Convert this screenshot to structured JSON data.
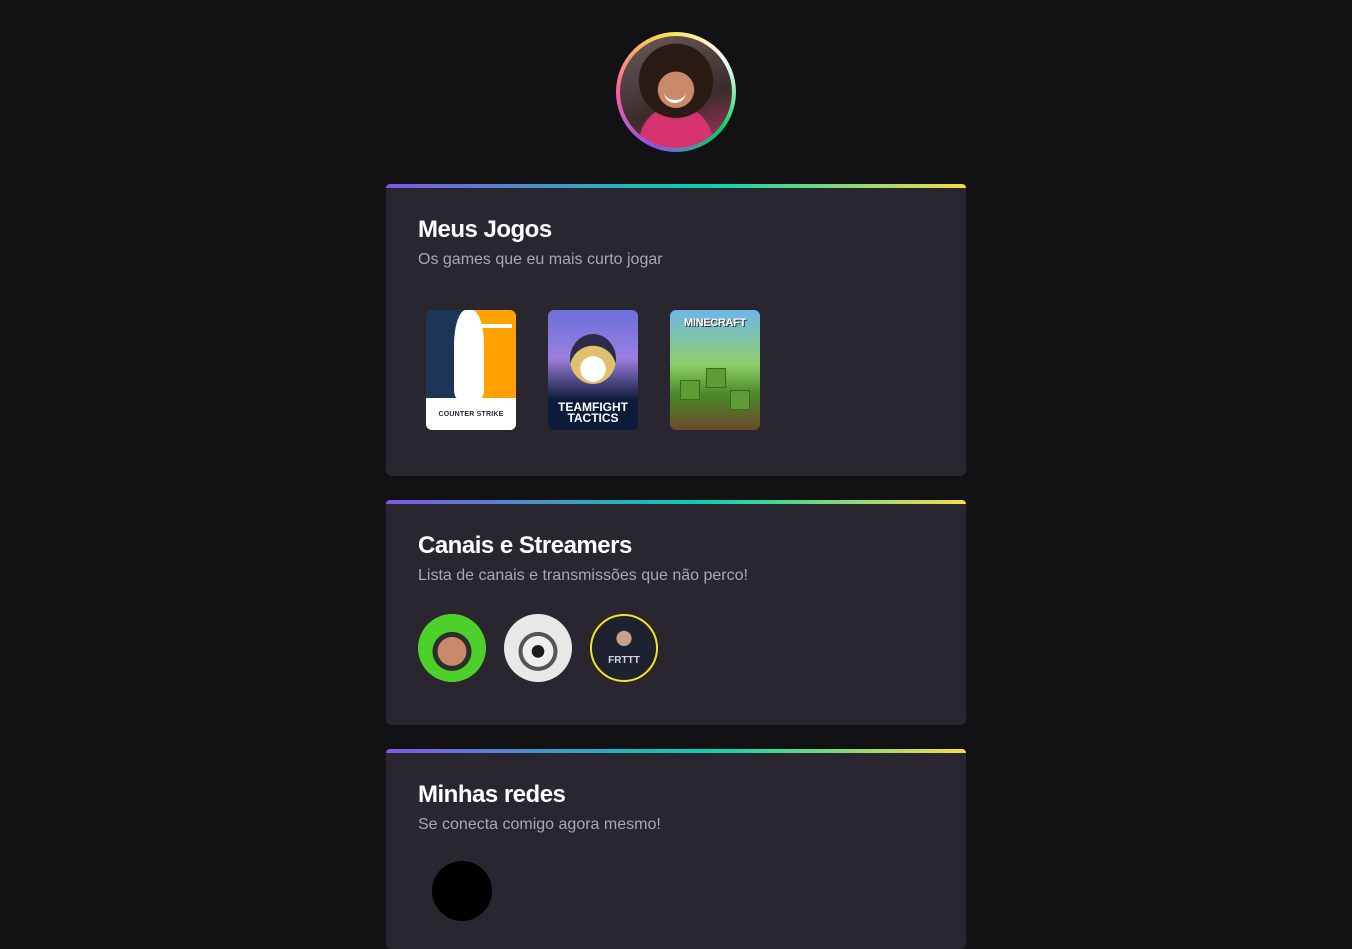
{
  "profile": {
    "avatar_alt": "Foto de perfil"
  },
  "games_card": {
    "title": "Meus Jogos",
    "subtitle": "Os games que eu mais curto jogar",
    "games": [
      {
        "name": "COUNTER STRIKE"
      },
      {
        "name": "TEAMFIGHT TACTICS"
      },
      {
        "name": "MINECRAFT"
      }
    ]
  },
  "channels_card": {
    "title": "Canais e Streamers",
    "subtitle": "Lista de canais e transmissões que não perco!",
    "streamer_3_text": "FRTTT"
  },
  "social_card": {
    "title": "Minhas redes",
    "subtitle": "Se conecta comigo agora mesmo!"
  },
  "colors": {
    "background": "#121214",
    "card": "#29262f",
    "accent_gradient": [
      "#8257e5",
      "#04d3b1",
      "#f7dd43"
    ]
  }
}
